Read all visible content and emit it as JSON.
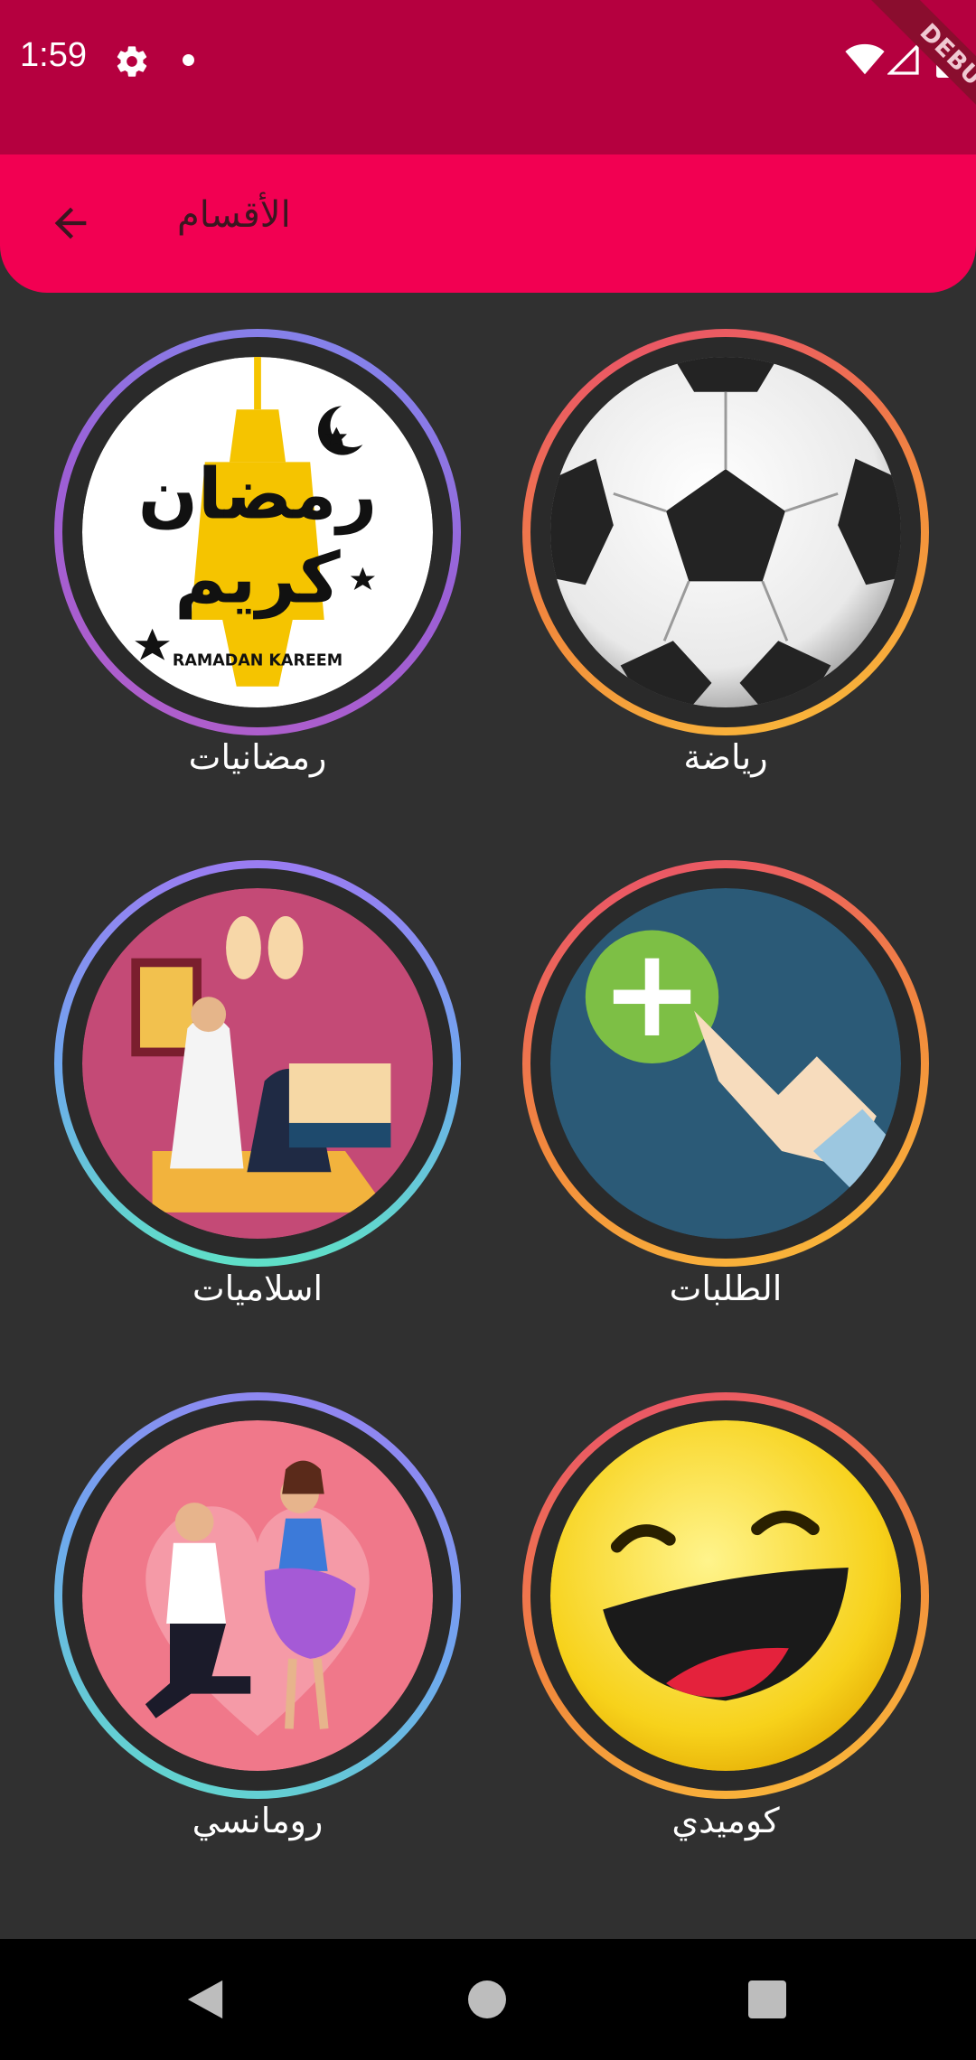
{
  "status_bar": {
    "time": "1:59",
    "icons": [
      "gear-icon",
      "dot-icon",
      "wifi-icon",
      "signal-icon",
      "battery-icon"
    ],
    "color": "#b5003f"
  },
  "debug_banner": {
    "label": "DEBUG"
  },
  "app_bar": {
    "title": "الأقسام",
    "back_icon": "arrow-left-icon",
    "color": "#f20052"
  },
  "categories": [
    {
      "label": "رياضة",
      "icon": "soccer-ball-icon"
    },
    {
      "label": "رمضانيات",
      "icon": "ramadan-kareem-lantern-icon",
      "image_text": "RAMADAN KAREEM"
    },
    {
      "label": "الطلبات",
      "icon": "add-request-hand-icon"
    },
    {
      "label": "اسلاميات",
      "icon": "praying-couple-icon"
    },
    {
      "label": "كوميدي",
      "icon": "laughing-emoji-icon"
    },
    {
      "label": "رومانسي",
      "icon": "romantic-proposal-icon"
    }
  ],
  "nav_bar": {
    "icons": [
      "nav-back-icon",
      "nav-home-icon",
      "nav-recents-icon"
    ]
  }
}
